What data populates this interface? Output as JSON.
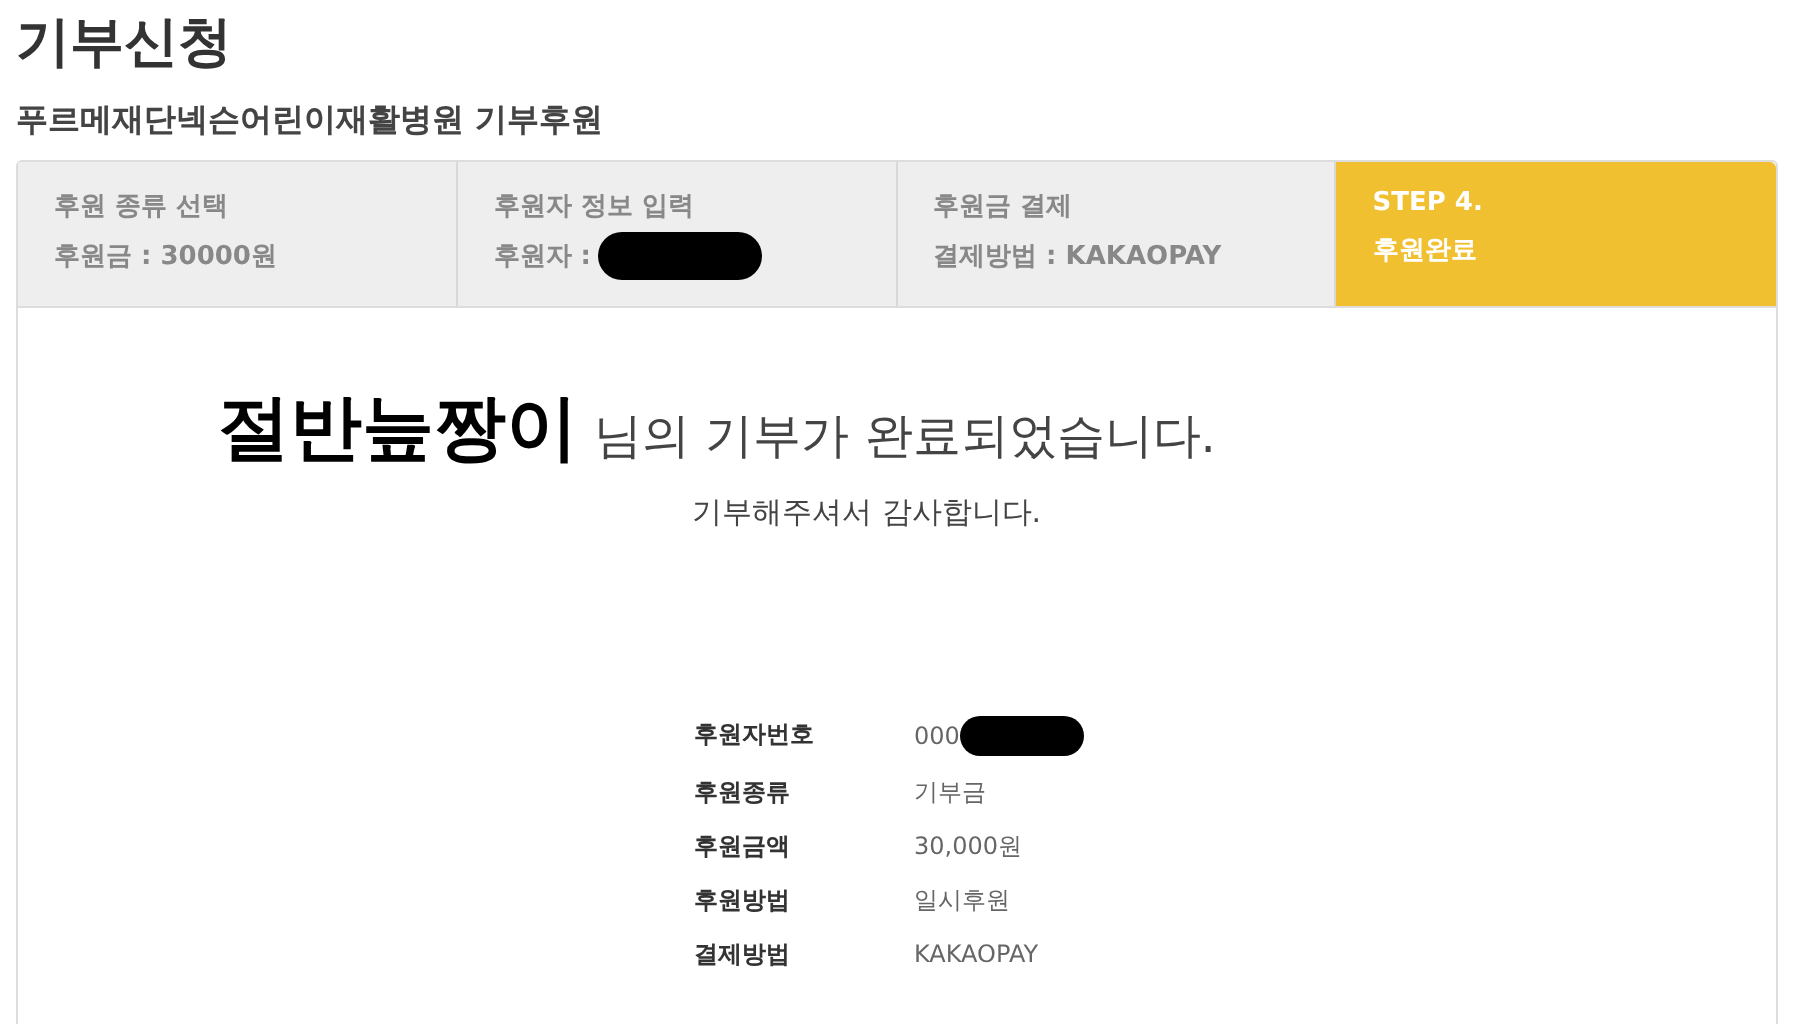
{
  "page": {
    "title": "기부신청",
    "subtitle": "푸르메재단넥슨어린이재활병원 기부후원"
  },
  "steps": [
    {
      "title": "후원 종류 선택",
      "detail": "후원금 : 30000원",
      "redacted": false,
      "selected": false
    },
    {
      "title": "후원자 정보 입력",
      "detail": "후원자 :",
      "redacted": true,
      "selected": false
    },
    {
      "title": "후원금 결제",
      "detail": "결제방법 : KAKAOPAY",
      "redacted": false,
      "selected": false
    },
    {
      "title": "STEP 4.",
      "detail": "후원완료",
      "redacted": false,
      "selected": true
    }
  ],
  "message": {
    "donor_name": "절반늪짱이",
    "text": "님의 기부가 완료되었습니다.",
    "thanks": "기부해주셔서 감사합니다."
  },
  "details": [
    {
      "label": "후원자번호",
      "value": "000",
      "redacted": true
    },
    {
      "label": "후원종류",
      "value": "기부금",
      "redacted": false
    },
    {
      "label": "후원금액",
      "value": "30,000원",
      "redacted": false
    },
    {
      "label": "후원방법",
      "value": "일시후원",
      "redacted": false
    },
    {
      "label": "결제방법",
      "value": "KAKAOPAY",
      "redacted": false
    }
  ]
}
